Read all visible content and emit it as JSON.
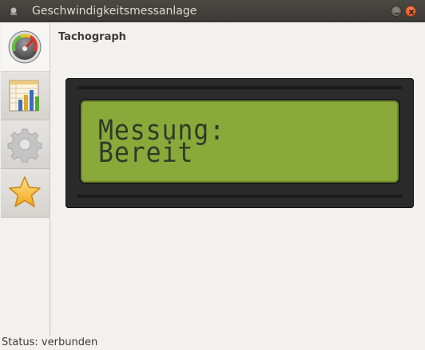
{
  "window": {
    "title": "Geschwindigkeitsmessanlage"
  },
  "tabs": [
    {
      "icon": "speedometer-icon",
      "active": true
    },
    {
      "icon": "spreadsheet-chart-icon",
      "active": false
    },
    {
      "icon": "gear-icon",
      "active": false
    },
    {
      "icon": "star-icon",
      "active": false
    }
  ],
  "page": {
    "title": "Tachograph"
  },
  "lcd": {
    "line1": "Messung:",
    "line2": "Bereit"
  },
  "status": {
    "text": "Status: verbunden"
  },
  "colors": {
    "lcd_bg": "#8aa93b",
    "lcd_text": "#2f3a28",
    "titlebar": "#3c3b37"
  }
}
